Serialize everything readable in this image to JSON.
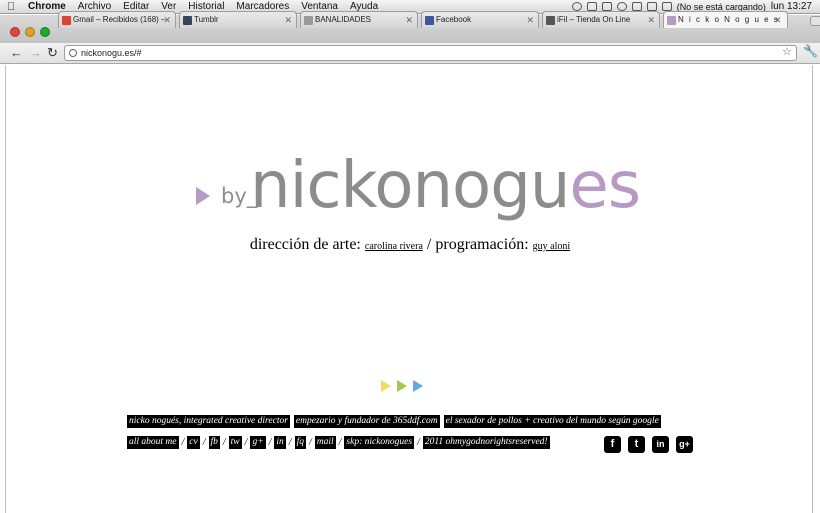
{
  "menubar": {
    "app": "Chrome",
    "items": [
      "Archivo",
      "Editar",
      "Ver",
      "Historial",
      "Marcadores",
      "Ventana",
      "Ayuda"
    ],
    "status": "(No se está cargando)",
    "clock": "lun 13:27"
  },
  "tabs": [
    {
      "label": "Gmail – Recibidos (168) –",
      "favicon_color": "#d44638"
    },
    {
      "label": "Tumblr",
      "favicon_color": "#35465c"
    },
    {
      "label": "BANALIDADES",
      "favicon_color": "#9a9a9a"
    },
    {
      "label": "Facebook",
      "favicon_color": "#3b5998"
    },
    {
      "label": "iFil – Tienda On Line",
      "favicon_color": "#555555"
    },
    {
      "label": "N i c k o N o g u e s",
      "favicon_color": "#b79ac4"
    }
  ],
  "toolbar": {
    "url": "nickonogu.es/#"
  },
  "logo": {
    "prefix": "by_",
    "name_main": "nickonogu",
    "name_accent": "es",
    "gray": "#8c8c8c",
    "accent_color": "#b79ac4"
  },
  "credits": {
    "art_label": "dirección de arte:",
    "art_name": "carolina rivera",
    "separator": "/",
    "prog_label": "programación:",
    "prog_name": "guy aloni"
  },
  "arrows": [
    "#f4da5f",
    "#a9c84a",
    "#5aaed8"
  ],
  "footer": {
    "row1": [
      "nicko nogués, integrated creative director",
      "empezario y fundador de 365ddf.com",
      "el sexador de pollos + creativo del mundo según google"
    ],
    "row2": [
      "all about me",
      "cv",
      "fb",
      "tw",
      "g+",
      "in",
      "fq",
      "mail",
      "skp: nickonogues",
      "2011 ohmygodnorightsreserved!"
    ],
    "social": [
      "f",
      "t",
      "in",
      "g+"
    ]
  }
}
